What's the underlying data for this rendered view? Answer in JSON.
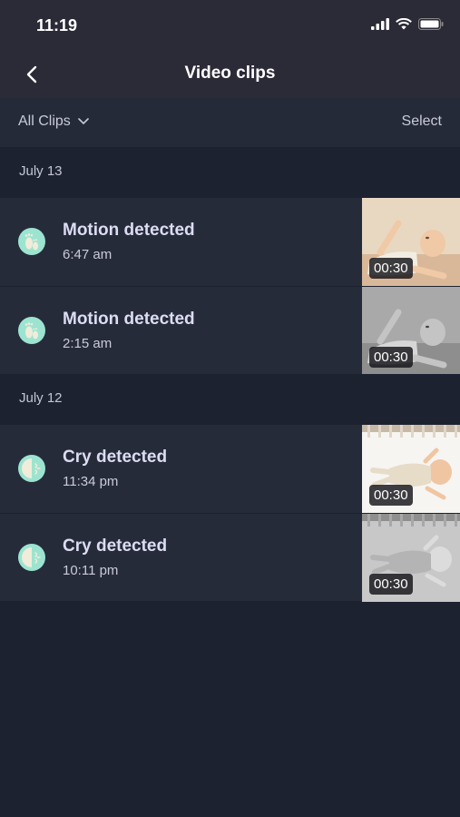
{
  "status_bar": {
    "time": "11:19"
  },
  "nav": {
    "title": "Video clips"
  },
  "filter_bar": {
    "filter_label": "All Clips",
    "select_label": "Select"
  },
  "sections": [
    {
      "date": "July 13",
      "clips": [
        {
          "title": "Motion detected",
          "time": "6:47 am",
          "duration": "00:30",
          "icon": "footprints-icon",
          "thumbnail": "color"
        },
        {
          "title": "Motion detected",
          "time": "2:15 am",
          "duration": "00:30",
          "icon": "footprints-icon",
          "thumbnail": "grayscale"
        }
      ]
    },
    {
      "date": "July 12",
      "clips": [
        {
          "title": "Cry detected",
          "time": "11:34 pm",
          "duration": "00:30",
          "icon": "crying-face-icon",
          "thumbnail": "color"
        },
        {
          "title": "Cry detected",
          "time": "10:11 pm",
          "duration": "00:30",
          "icon": "crying-face-icon",
          "thumbnail": "grayscale"
        }
      ]
    }
  ],
  "colors": {
    "background": "#1c2230",
    "header": "#2b2a37",
    "row": "#262b3a",
    "icon_accent": "#9ce4d0",
    "title_text": "#dcdcf2"
  }
}
